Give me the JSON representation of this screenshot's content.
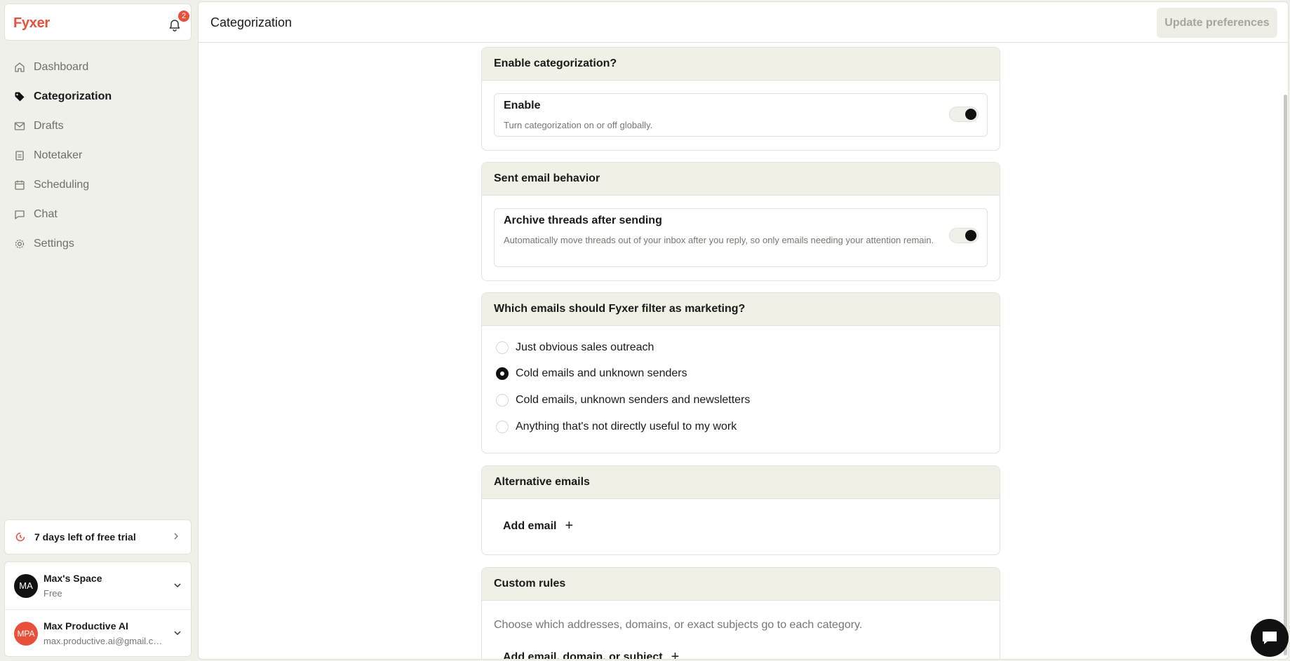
{
  "brand": {
    "name": "Fyxer",
    "notifications_count": "2"
  },
  "sidebar": {
    "items": [
      {
        "label": "Dashboard",
        "icon": "home-icon"
      },
      {
        "label": "Categorization",
        "icon": "tag-icon",
        "active": true
      },
      {
        "label": "Drafts",
        "icon": "mail-icon"
      },
      {
        "label": "Notetaker",
        "icon": "clipboard-icon"
      },
      {
        "label": "Scheduling",
        "icon": "calendar-icon"
      },
      {
        "label": "Chat",
        "icon": "chat-bubble-icon"
      },
      {
        "label": "Settings",
        "icon": "gear-icon"
      }
    ],
    "trial": {
      "label": "7 days left of free trial"
    },
    "workspace": {
      "initials": "MA",
      "name": "Max's Space",
      "plan": "Free"
    },
    "user": {
      "initials": "MPA",
      "name": "Max Productive AI",
      "email": "max.productive.ai@gmail.com"
    }
  },
  "header": {
    "title": "Categorization",
    "update_button": "Update preferences"
  },
  "sections": {
    "enable": {
      "title": "Enable categorization?",
      "setting_title": "Enable",
      "setting_desc": "Turn categorization on or off globally.",
      "on": true
    },
    "sent": {
      "title": "Sent email behavior",
      "setting_title": "Archive threads after sending",
      "setting_desc": "Automatically move threads out of your inbox after you reply, so only emails needing your attention remain.",
      "on": true
    },
    "marketing": {
      "title": "Which emails should Fyxer filter as marketing?",
      "options": [
        "Just obvious sales outreach",
        "Cold emails and unknown senders",
        "Cold emails, unknown senders and newsletters",
        "Anything that's not directly useful to my work"
      ],
      "selected": "Cold emails and unknown senders"
    },
    "alternative": {
      "title": "Alternative emails",
      "add_label": "Add email"
    },
    "custom": {
      "title": "Custom rules",
      "description": "Choose which addresses, domains, or exact subjects go to each category.",
      "add_label": "Add email, domain, or subject"
    }
  },
  "colors": {
    "accent": "#e8503a",
    "sidebar_bg": "#f0f0ea",
    "section_head_bg": "#f0f0e6"
  }
}
